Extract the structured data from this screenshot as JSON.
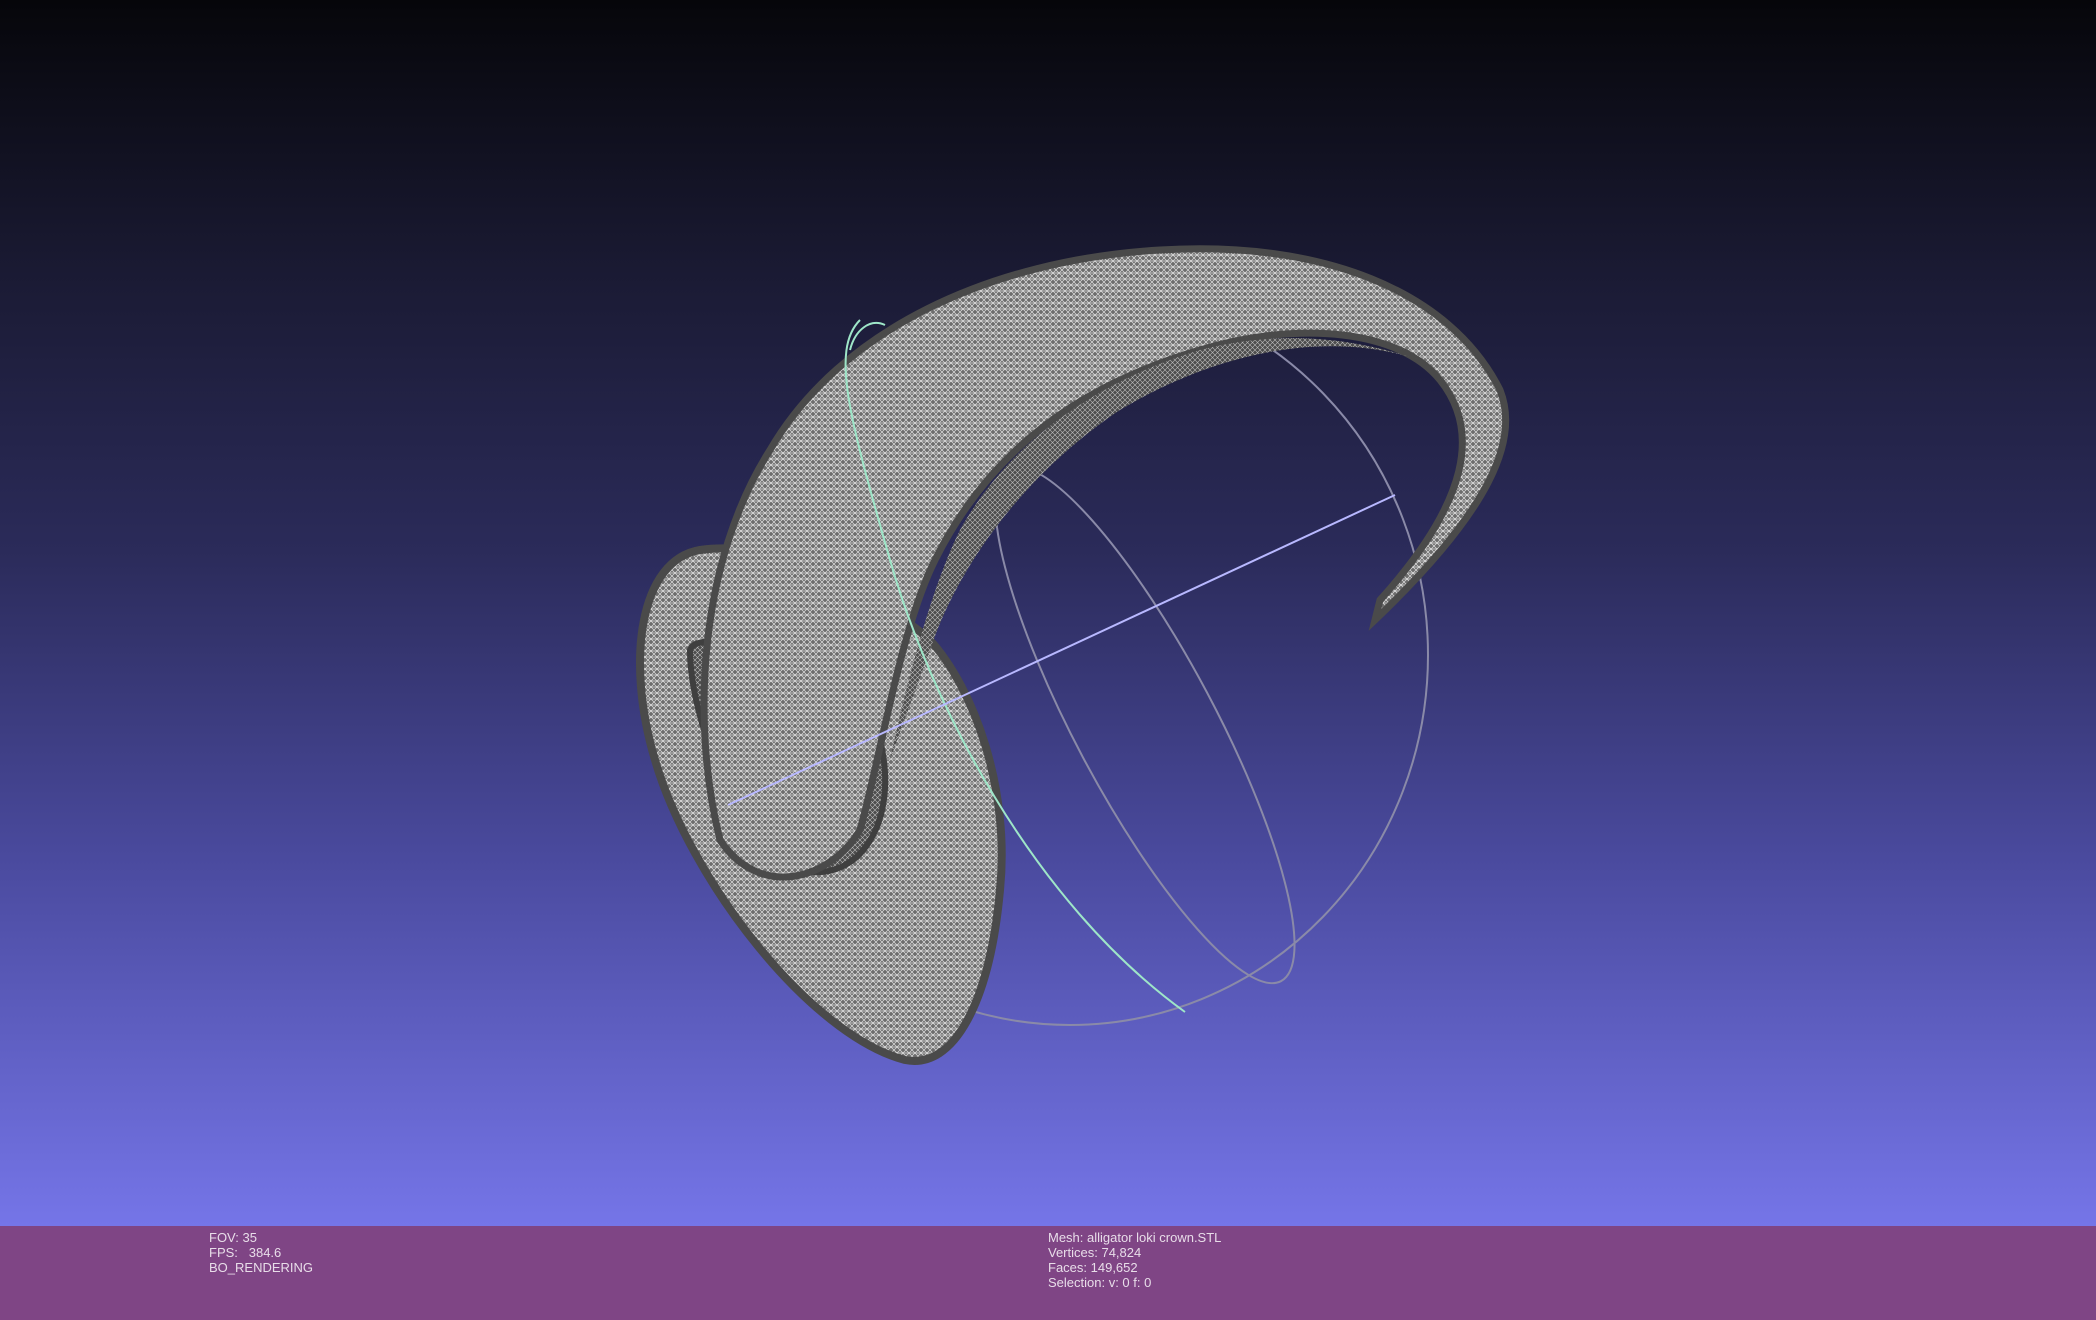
{
  "viewer": {
    "background_top": "#06060a",
    "background_bottom": "#7575e8",
    "info_bar_color": "#7f4585",
    "mesh_color": "#6a6a6a",
    "mesh_line_color": "#d8d8d8",
    "trackball_colors": [
      "#8a8aa8",
      "#9ee6c8",
      "#b8b8ff"
    ]
  },
  "info_left": {
    "fov": "FOV: 35",
    "fps": "FPS:   384.6",
    "mode": "BO_RENDERING"
  },
  "info_right": {
    "mesh": "Mesh: alligator loki crown.STL",
    "vertices": "Vertices: 74,824",
    "faces": "Faces: 149,652",
    "selection": "Selection: v: 0 f: 0"
  }
}
